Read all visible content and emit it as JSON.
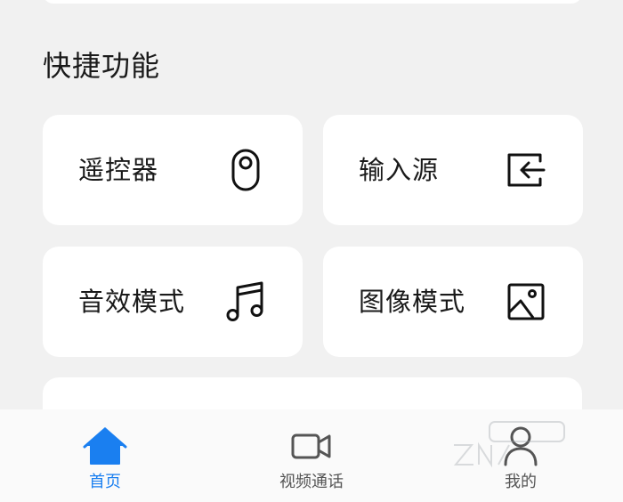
{
  "section": {
    "title": "快捷功能"
  },
  "tiles": [
    {
      "label": "遥控器",
      "icon": "remote-control-icon"
    },
    {
      "label": "输入源",
      "icon": "input-source-icon"
    },
    {
      "label": "音效模式",
      "icon": "music-note-icon"
    },
    {
      "label": "图像模式",
      "icon": "image-icon"
    }
  ],
  "bottom_nav": {
    "items": [
      {
        "label": "首页",
        "icon": "home-icon",
        "active": true
      },
      {
        "label": "视频通话",
        "icon": "video-camera-icon",
        "active": false
      },
      {
        "label": "我的",
        "icon": "person-icon",
        "active": false
      }
    ]
  },
  "colors": {
    "accent": "#1a7ff0",
    "background": "#f1f1f1",
    "card": "#ffffff",
    "text": "#1a1a1a",
    "nav_inactive": "#555555"
  }
}
